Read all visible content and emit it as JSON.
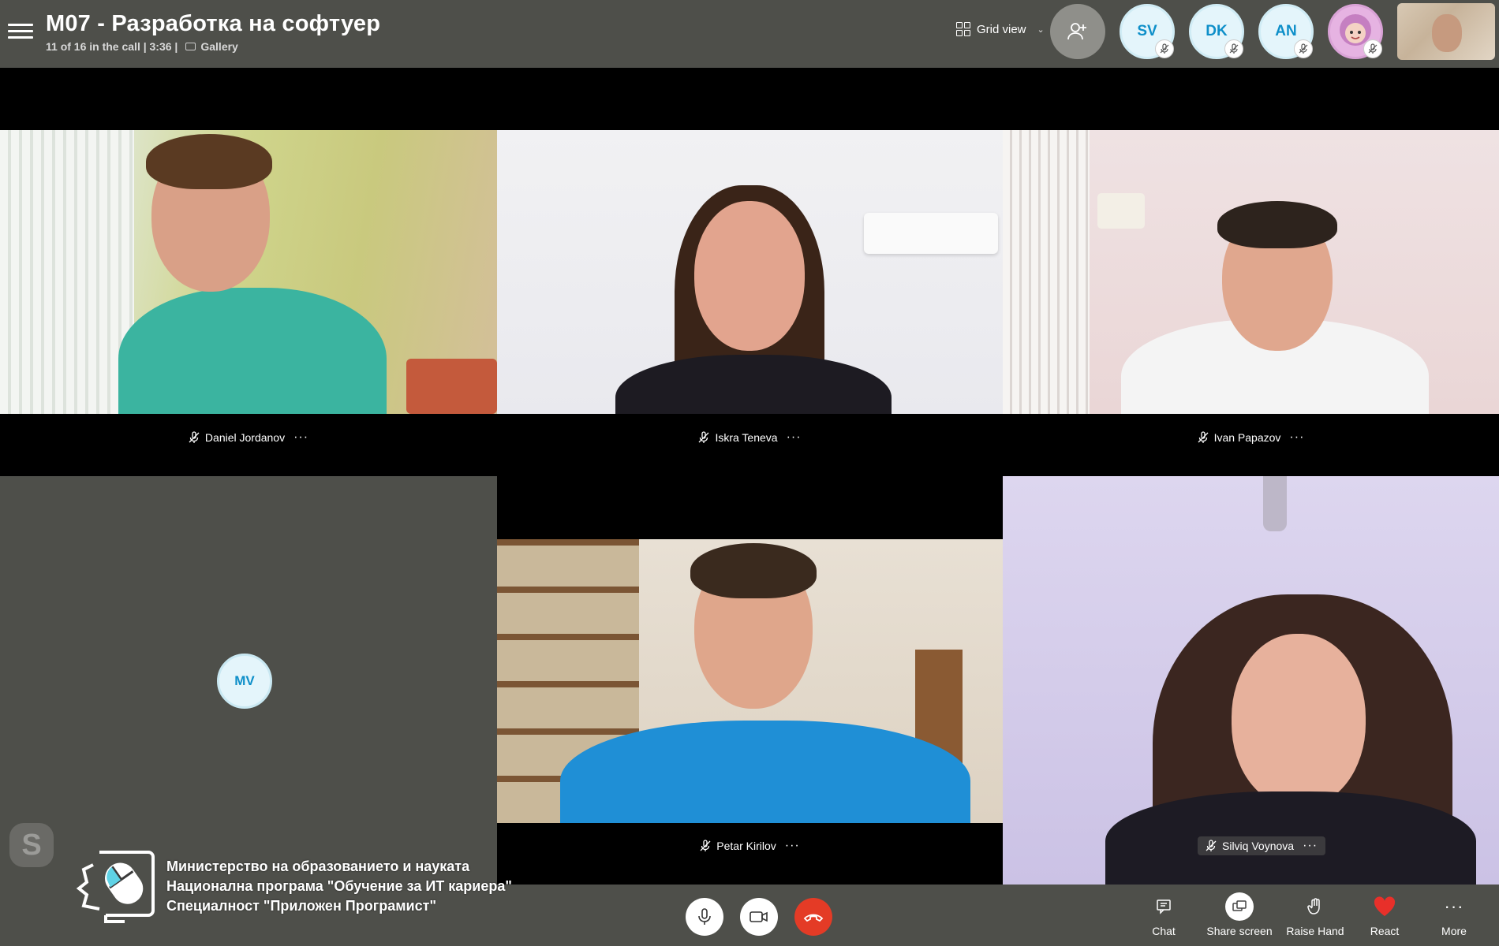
{
  "header": {
    "title": "M07 - Разработка на софтуер",
    "call_info": "11 of 16 in the call | 3:36 |",
    "layout_label": "Gallery",
    "view_label": "Grid view"
  },
  "participants_bar": [
    {
      "initials": "SV",
      "muted": true
    },
    {
      "initials": "DK",
      "muted": true
    },
    {
      "initials": "AN",
      "muted": true
    },
    {
      "initials": "",
      "muted": true
    }
  ],
  "tiles": [
    {
      "name": "Daniel Jordanov",
      "muted": true
    },
    {
      "name": "Iskra Teneva",
      "muted": true
    },
    {
      "name": "Ivan Papazov",
      "muted": true
    },
    {
      "initials": "MV"
    },
    {
      "name": "Petar Kirilov",
      "muted": true
    },
    {
      "name": "Silviq Voynova",
      "muted": true
    }
  ],
  "toolbar": {
    "chat": "Chat",
    "share": "Share screen",
    "raise_hand": "Raise Hand",
    "react": "React",
    "more": "More"
  },
  "overlay": {
    "line1": "Министерство на образованието и науката",
    "line2": "Национална програма \"Обучение за ИТ кариера\"",
    "line3": "Специалност \"Приложен Програмист\""
  },
  "colors": {
    "bar": "#4e4f4a",
    "avatar_text": "#0e8fc9",
    "end_call": "#e43b26"
  }
}
